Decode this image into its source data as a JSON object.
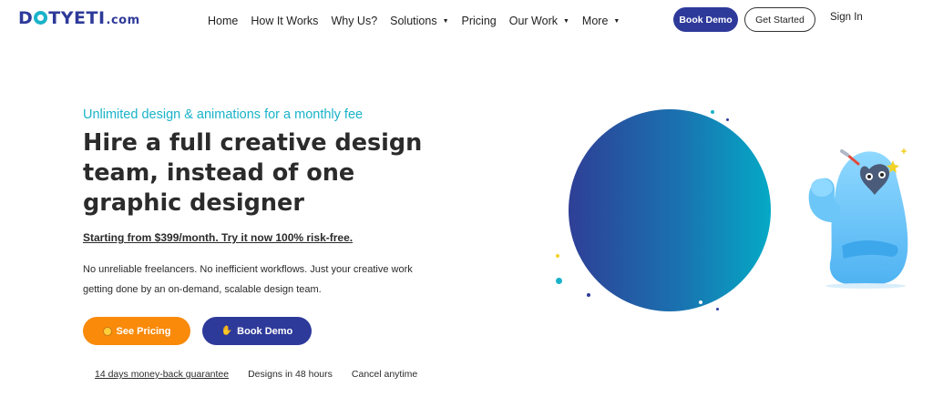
{
  "brand": {
    "name": "DOTYETI",
    "suffix": ".com"
  },
  "nav": {
    "items": [
      {
        "label": "Home",
        "dropdown": false
      },
      {
        "label": "How It Works",
        "dropdown": false
      },
      {
        "label": "Why Us?",
        "dropdown": false
      },
      {
        "label": "Solutions",
        "dropdown": true
      },
      {
        "label": "Pricing",
        "dropdown": false
      },
      {
        "label": "Our Work",
        "dropdown": true
      },
      {
        "label": "More",
        "dropdown": true
      }
    ],
    "book_demo": "Book Demo",
    "get_started": "Get Started",
    "sign_in": "Sign In"
  },
  "hero": {
    "eyebrow": "Unlimited design & animations for a monthly fee",
    "headline": "Hire a full creative design team, instead of one graphic designer",
    "pricing_link": "Starting from $399/month. Try it now 100% risk-free.",
    "description": "No unreliable freelancers. No inefficient workflows. Just your creative work getting done by an on-demand, scalable design team.",
    "cta_pricing": "See Pricing",
    "cta_demo": "Book Demo",
    "perks": [
      {
        "label": "14 days money-back guarantee",
        "link": true
      },
      {
        "label": "Designs in 48 hours",
        "link": false
      },
      {
        "label": "Cancel anytime",
        "link": false
      }
    ]
  },
  "colors": {
    "brand_navy": "#2e3a9a",
    "accent_teal": "#19b3c9",
    "cta_orange": "#f98a0a"
  },
  "icons": {
    "cta_pricing": "smiley-emoji-icon",
    "cta_demo": "waving-hand-emoji-icon",
    "caret": "caret-down-icon"
  }
}
